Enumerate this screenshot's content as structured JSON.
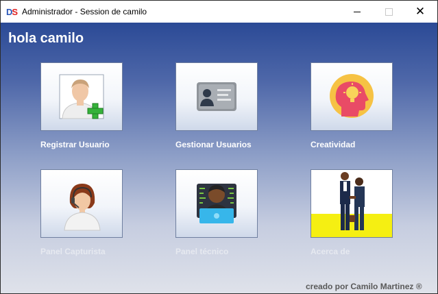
{
  "window": {
    "title": "Administrador - Session de camilo",
    "icon": "ds-app-icon",
    "controls": {
      "minimize": "minimize-icon",
      "maximize": "maximize-icon",
      "close": "close-icon"
    }
  },
  "greeting": "hola camilo",
  "tiles": [
    {
      "label": "Registrar Usuario",
      "icon": "add-user-icon"
    },
    {
      "label": "Gestionar Usuarios",
      "icon": "id-card-icon"
    },
    {
      "label": "Creatividad",
      "icon": "idea-head-icon"
    },
    {
      "label": "Panel Capturista",
      "icon": "operator-headset-icon"
    },
    {
      "label": "Panel técnico",
      "icon": "technician-laptop-icon"
    },
    {
      "label": "Acerca de",
      "icon": "handshake-icon"
    }
  ],
  "footer": {
    "credit": "creado por Camilo Martinez ®"
  },
  "colors": {
    "client_top": "#2b4a96",
    "client_bottom": "#dfe2ea",
    "label_text": "#ffffff",
    "credit_text": "#595959"
  }
}
